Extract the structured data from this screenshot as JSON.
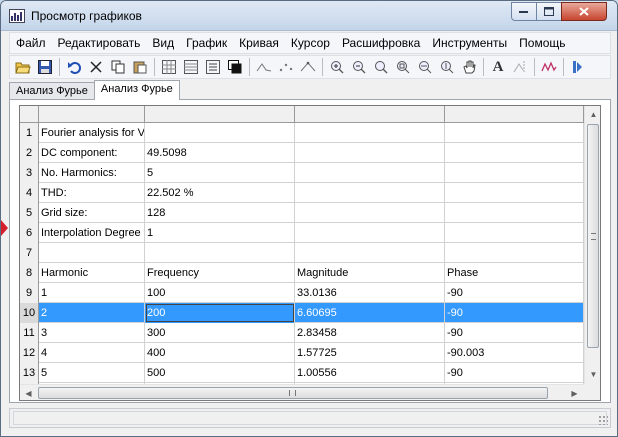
{
  "window": {
    "title": "Просмотр графиков"
  },
  "menu": [
    {
      "label": "Файл",
      "name": "menu-file"
    },
    {
      "label": "Редактировать",
      "name": "menu-edit"
    },
    {
      "label": "Вид",
      "name": "menu-view"
    },
    {
      "label": "График",
      "name": "menu-plot"
    },
    {
      "label": "Кривая",
      "name": "menu-curve"
    },
    {
      "label": "Курсор",
      "name": "menu-cursor"
    },
    {
      "label": "Расшифровка",
      "name": "menu-decode"
    },
    {
      "label": "Инструменты",
      "name": "menu-tools"
    },
    {
      "label": "Помощь",
      "name": "menu-help"
    }
  ],
  "toolbar_icons": [
    "open-folder-icon",
    "save-icon",
    "undo-icon",
    "cut-icon",
    "copy-icon",
    "paste-icon",
    "grid-icon",
    "table-icon",
    "list-icon",
    "window-icon",
    "wave-icon",
    "dots-icon",
    "peaks-icon",
    "zoom-in-icon",
    "zoom-out-icon",
    "zoom-area-icon",
    "zoom-fit-icon",
    "zoom-x-icon",
    "zoom-y-icon",
    "pan-hand-icon",
    "text-icon",
    "cursor-icon",
    "wave-icon-2",
    "next-icon"
  ],
  "tabs": [
    {
      "label": "Анализ Фурье",
      "active": false
    },
    {
      "label": "Анализ Фурье",
      "active": true
    }
  ],
  "grid": {
    "rows": [
      {
        "num": "1",
        "cells": [
          "Fourier analysis for V",
          "",
          "",
          ""
        ]
      },
      {
        "num": "2",
        "cells": [
          "DC component:",
          "49.5098",
          "",
          ""
        ]
      },
      {
        "num": "3",
        "cells": [
          "No. Harmonics:",
          "5",
          "",
          ""
        ]
      },
      {
        "num": "4",
        "cells": [
          "THD:",
          "22.502 %",
          "",
          ""
        ]
      },
      {
        "num": "5",
        "cells": [
          "Grid size:",
          "128",
          "",
          ""
        ]
      },
      {
        "num": "6",
        "cells": [
          "Interpolation Degree",
          "1",
          "",
          ""
        ]
      },
      {
        "num": "7",
        "cells": [
          "",
          "",
          "",
          ""
        ]
      },
      {
        "num": "8",
        "cells": [
          "Harmonic",
          "Frequency",
          "Magnitude",
          "Phase"
        ]
      },
      {
        "num": "9",
        "cells": [
          "1",
          "100",
          "33.0136",
          "-90"
        ]
      },
      {
        "num": "10",
        "cells": [
          "2",
          "200",
          "6.60695",
          "-90"
        ],
        "selected": true
      },
      {
        "num": "11",
        "cells": [
          "3",
          "300",
          "2.83458",
          "-90"
        ]
      },
      {
        "num": "12",
        "cells": [
          "4",
          "400",
          "1.57725",
          "-90.003"
        ]
      },
      {
        "num": "13",
        "cells": [
          "5",
          "500",
          "1.00556",
          "-90"
        ]
      },
      {
        "num": "14",
        "cells": [
          "",
          "",
          "",
          ""
        ]
      }
    ]
  },
  "colors": {
    "selection": "#3399ff",
    "marker": "#d4202c"
  }
}
